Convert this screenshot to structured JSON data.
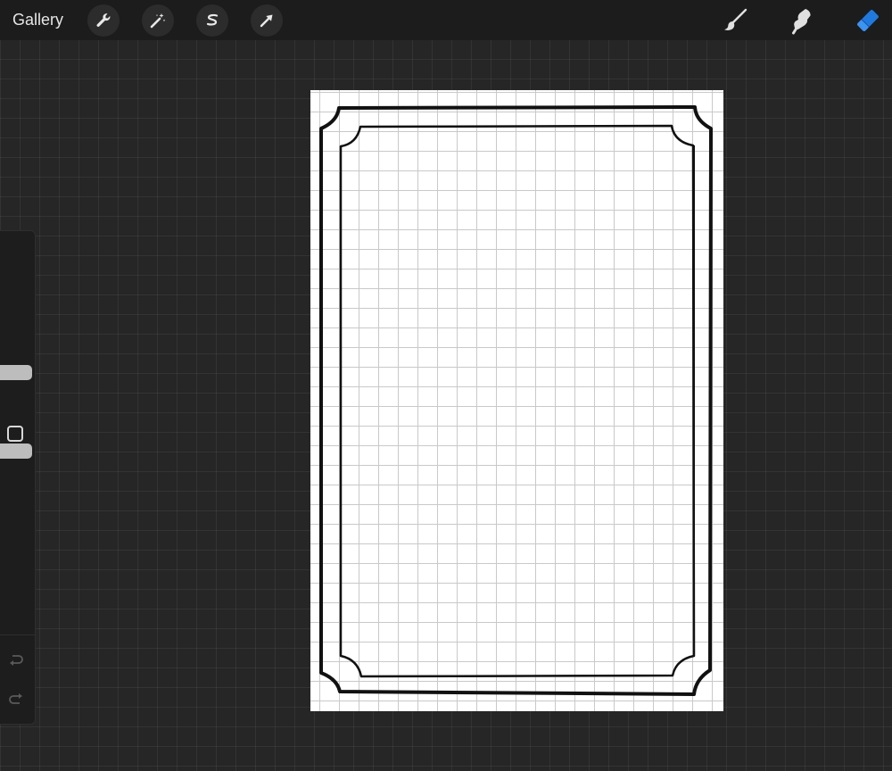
{
  "topbar": {
    "gallery_label": "Gallery",
    "left_tools": [
      {
        "name": "wrench-icon",
        "action": "actions"
      },
      {
        "name": "magic-wand-icon",
        "action": "adjustments"
      },
      {
        "name": "selection-icon",
        "action": "selection"
      },
      {
        "name": "arrow-cursor-icon",
        "action": "transform"
      }
    ],
    "right_tools": [
      {
        "name": "brush-icon",
        "action": "paint"
      },
      {
        "name": "smudge-icon",
        "action": "smudge"
      },
      {
        "name": "eraser-icon",
        "action": "erase",
        "active": true
      }
    ]
  },
  "sidebar": {
    "brush_size_level": 0.31,
    "brush_opacity_level": 0.52
  },
  "colors": {
    "accent": "#1f7ae0",
    "bar": "#1c1c1c",
    "workspace": "#262626",
    "paper": "#ffffff",
    "ink": "#111111"
  }
}
